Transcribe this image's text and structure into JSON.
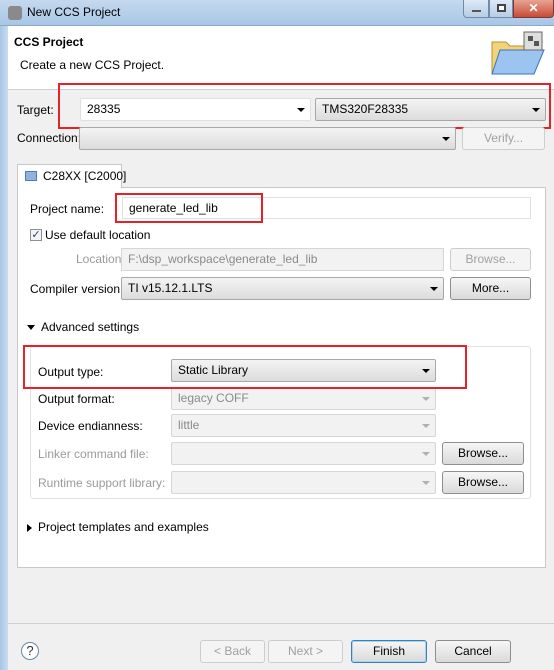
{
  "window": {
    "title": "New CCS Project"
  },
  "header": {
    "title": "CCS Project",
    "subtitle": "Create a new CCS Project."
  },
  "target": {
    "label": "Target:",
    "family_value": "28335",
    "device_value": "TMS320F28335"
  },
  "connection": {
    "label": "Connection:",
    "value": "",
    "verify_label": "Verify..."
  },
  "tab": {
    "label": "C28XX [C2000]"
  },
  "project": {
    "name_label": "Project name:",
    "name_value": "generate_led_lib",
    "use_default_label": "Use default location",
    "use_default_checked": true,
    "location_label": "Location:",
    "location_value": "F:\\dsp_workspace\\generate_led_lib",
    "browse_label": "Browse...",
    "compiler_label": "Compiler version:",
    "compiler_value": "TI v15.12.1.LTS",
    "more_label": "More..."
  },
  "advanced": {
    "label": "Advanced settings",
    "output_type_label": "Output type:",
    "output_type_value": "Static Library",
    "output_format_label": "Output format:",
    "output_format_value": "legacy COFF",
    "endianness_label": "Device endianness:",
    "endianness_value": "little",
    "linker_label": "Linker command file:",
    "linker_value": "",
    "linker_browse": "Browse...",
    "rts_label": "Runtime support library:",
    "rts_value": "",
    "rts_browse": "Browse..."
  },
  "templates": {
    "label": "Project templates and examples"
  },
  "footer": {
    "back": "< Back",
    "next": "Next >",
    "finish": "Finish",
    "cancel": "Cancel"
  },
  "colors": {
    "highlight": "#e8202a",
    "titlebar": "#a9c6e6"
  }
}
